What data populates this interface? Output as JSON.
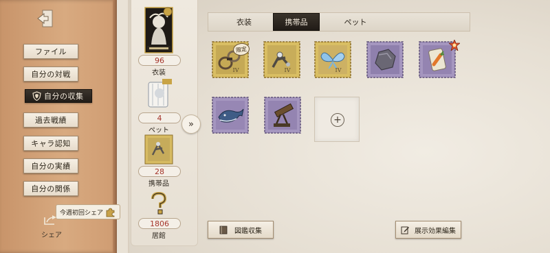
{
  "sidebar": {
    "items": [
      {
        "label": "ファイル"
      },
      {
        "label": "自分の対戦"
      },
      {
        "label": "自分の収集",
        "active": true
      },
      {
        "label": "過去戦績"
      },
      {
        "label": "キャラ認知"
      },
      {
        "label": "自分の実績"
      },
      {
        "label": "自分の関係"
      }
    ],
    "share_tip": "今週初回シェア",
    "share_label": "シェア"
  },
  "stats": {
    "costume": {
      "value": "96",
      "label": "衣装"
    },
    "pet": {
      "value": "4",
      "label": "ペット"
    },
    "accessory": {
      "value": "28",
      "label": "携帯品"
    },
    "residence": {
      "value": "1806",
      "label": "居館"
    }
  },
  "tabs": [
    {
      "label": "衣装"
    },
    {
      "label": "携帯品",
      "active": true
    },
    {
      "label": "ペット"
    }
  ],
  "items": {
    "limited_tag": "限定",
    "gen_badge": "IV",
    "list": [
      {
        "icon": "handcuffs-stamp-icon",
        "frame": "gold"
      },
      {
        "icon": "mechanical-arm-stamp-icon",
        "frame": "gold"
      },
      {
        "icon": "blue-butterfly-stamp-icon",
        "frame": "gold"
      },
      {
        "icon": "rock-stamp-icon",
        "frame": "purple"
      },
      {
        "icon": "carrot-bag-stamp-icon",
        "frame": "purple"
      },
      {
        "icon": "whale-stamp-icon",
        "frame": "purple"
      },
      {
        "icon": "telescope-stamp-icon",
        "frame": "purple"
      }
    ]
  },
  "buttons": {
    "codex": "図鑑収集",
    "display_edit": "展示効果編集"
  },
  "colors": {
    "accent_red": "#a5342a",
    "active_dark": "#2a241e",
    "gold_frame": "#c9a446",
    "purple_frame": "#9a8ab2"
  }
}
